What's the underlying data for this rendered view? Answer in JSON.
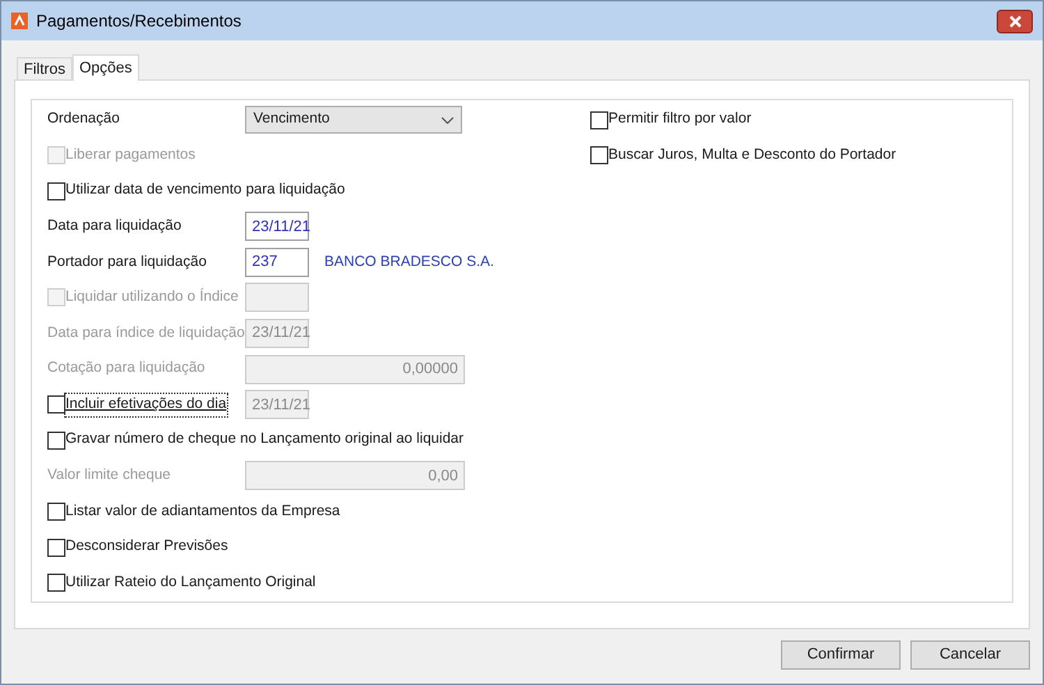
{
  "window": {
    "title": "Pagamentos/Recebimentos"
  },
  "tabs": [
    {
      "label": "Filtros",
      "selected": false
    },
    {
      "label": "Opções",
      "selected": true
    }
  ],
  "left_rows": [
    {
      "kind": "select",
      "label": "Ordenação",
      "value": "Vencimento"
    },
    {
      "kind": "checkbox",
      "label": "Liberar pagamentos",
      "checked": false,
      "disabled": true
    },
    {
      "kind": "checkbox",
      "label": "Utilizar data de vencimento para liquidação",
      "checked": false,
      "disabled": false
    },
    {
      "kind": "field",
      "label": "Data para liquidação",
      "value": "23/11/21",
      "disabled": false,
      "wide": false
    },
    {
      "kind": "field",
      "label": "Portador para liquidação",
      "value": "237",
      "disabled": false,
      "wide": false,
      "note": "BANCO BRADESCO S.A."
    },
    {
      "kind": "checkfield",
      "label": "Liquidar utilizando o Índice",
      "checked": false,
      "disabled": true,
      "value": "",
      "field_disabled": true
    },
    {
      "kind": "field",
      "label": "Data para índice de liquidação",
      "value": "23/11/21",
      "disabled": true,
      "wide": false
    },
    {
      "kind": "field",
      "label": "Cotação para liquidação",
      "value": "0,00000",
      "disabled": true,
      "wide": true
    },
    {
      "kind": "checkfield",
      "label": "Incluir efetivações do dia",
      "checked": false,
      "disabled": false,
      "focused": true,
      "value": "23/11/21",
      "field_disabled": true
    },
    {
      "kind": "checkbox",
      "label": "Gravar número de cheque no Lançamento original ao liquidar",
      "checked": false,
      "disabled": false
    },
    {
      "kind": "field",
      "label": "Valor limite cheque",
      "value": "0,00",
      "disabled": true,
      "wide": true
    },
    {
      "kind": "checkbox",
      "label": "Listar valor de adiantamentos da Empresa",
      "checked": false,
      "disabled": false
    },
    {
      "kind": "checkbox",
      "label": "Desconsiderar Previsões",
      "checked": false,
      "disabled": false
    },
    {
      "kind": "checkbox",
      "label": "Utilizar Rateio do Lançamento Original",
      "checked": false,
      "disabled": false
    }
  ],
  "right_rows": [
    {
      "label": "Permitir filtro por valor",
      "checked": false
    },
    {
      "label": "Buscar Juros, Multa e Desconto do Portador",
      "checked": false
    }
  ],
  "buttons": [
    {
      "label": "Confirmar"
    },
    {
      "label": "Cancelar"
    }
  ]
}
